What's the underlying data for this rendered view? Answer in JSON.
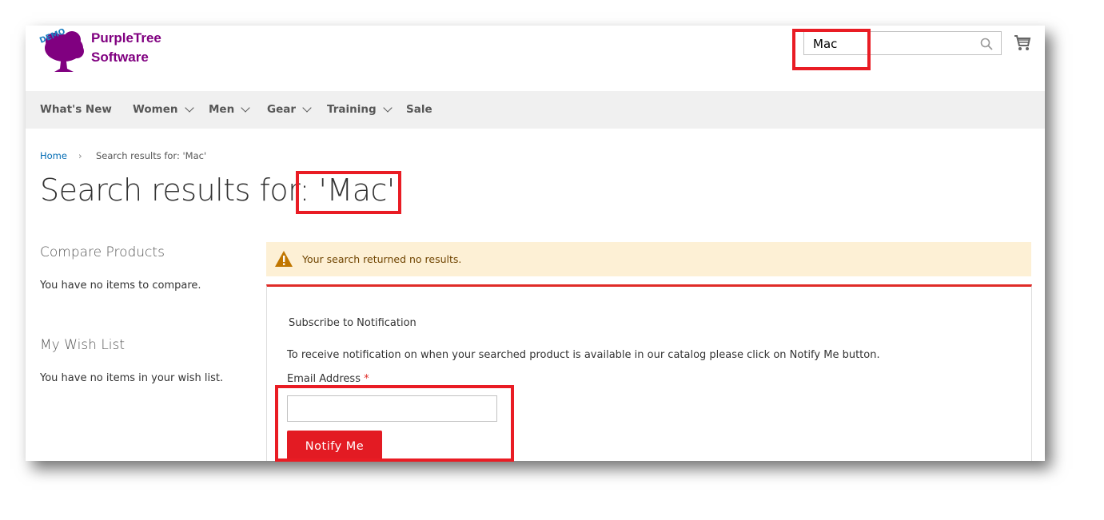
{
  "logo": {
    "badge": "DEMO",
    "line1": "PurpleTree",
    "line2": "Software",
    "color": "#800080"
  },
  "header": {
    "search_value": "Mac",
    "search_icon": "search-icon",
    "cart_icon": "cart-icon"
  },
  "nav": {
    "items": [
      {
        "label": "What's New"
      },
      {
        "label": "Women"
      },
      {
        "label": "Men"
      },
      {
        "label": "Gear"
      },
      {
        "label": "Training"
      },
      {
        "label": "Sale"
      }
    ]
  },
  "breadcrumb": {
    "home": "Home",
    "current": "Search results for: 'Mac'"
  },
  "page_title": {
    "prefix": "Search results for:",
    "query": "'Mac'"
  },
  "sidebar": {
    "compare_title": "Compare Products",
    "compare_text": "You have no items to compare.",
    "wishlist_title": "My Wish List",
    "wishlist_text": "You have no items in your wish list."
  },
  "message": {
    "text": "Your search returned no results.",
    "icon": "warning-icon"
  },
  "notify": {
    "title": "Subscribe to Notification",
    "description": "To receive notification on when your searched product is available in our catalog please click on Notify Me button.",
    "email_label": "Email Address",
    "required_mark": "*",
    "email_value": "",
    "button": "Notify Me"
  },
  "colors": {
    "accent": "#e31b23",
    "highlight": "#e91c24",
    "link": "#006bb4",
    "warning_bg": "#fdf0d5"
  }
}
